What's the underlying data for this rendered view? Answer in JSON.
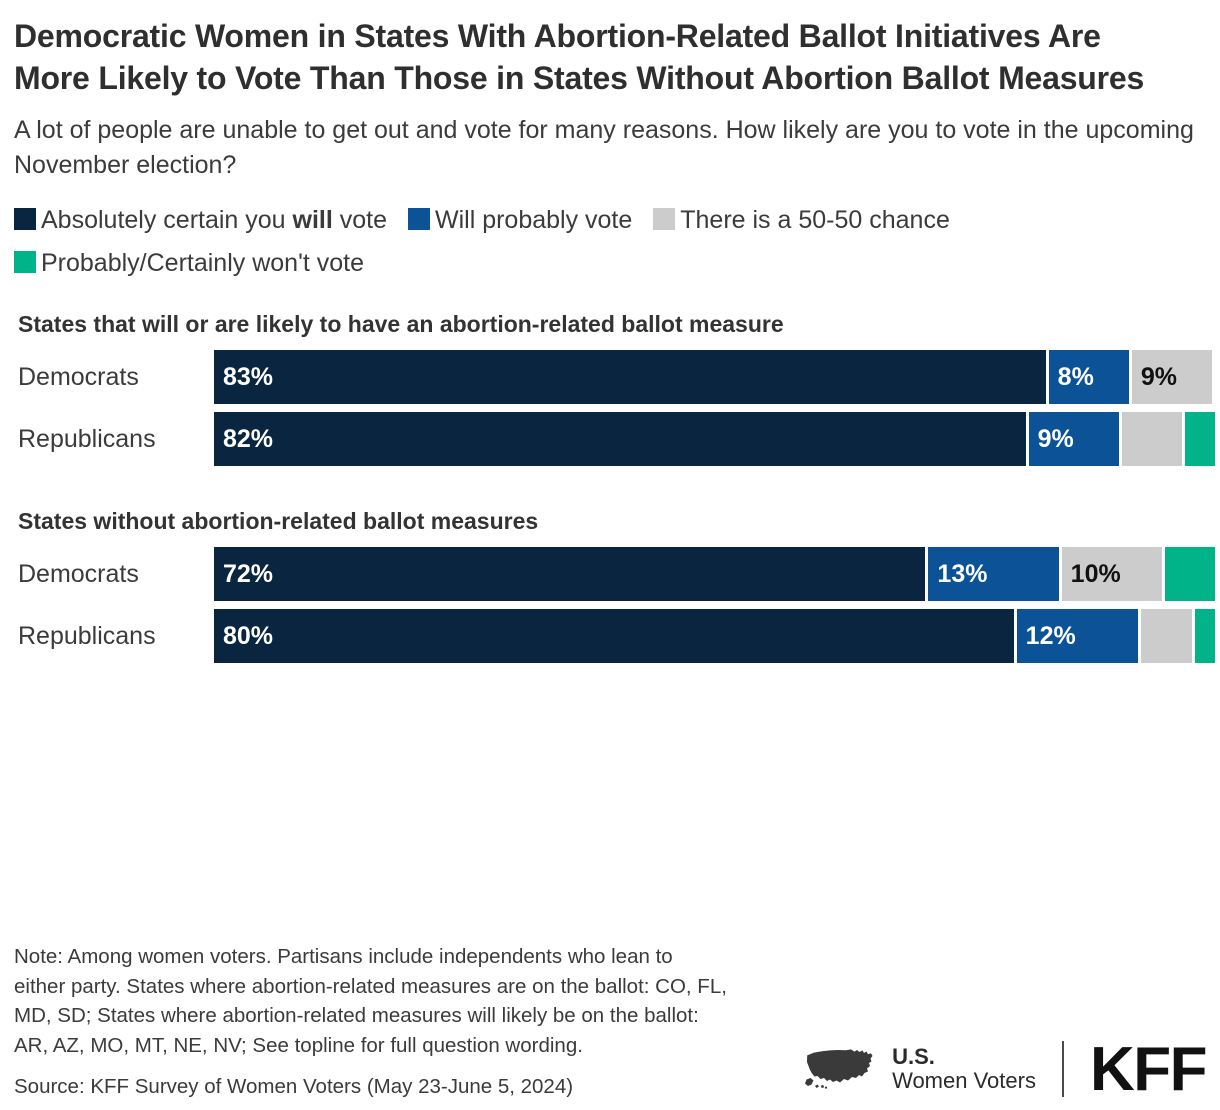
{
  "title": "Democratic Women in States With Abortion-Related Ballot Initiatives Are More Likely to Vote Than Those in States Without Abortion Ballot Measures",
  "subtitle": "A lot of people are unable to get out and vote for many reasons. How likely are you to vote in the upcoming November election?",
  "legend": [
    {
      "label_pre": "Absolutely certain you ",
      "label_bold": "will",
      "label_post": " vote",
      "color": "#0a2540",
      "name": "absolutely-certain-will-vote"
    },
    {
      "label_pre": "Will probably vote",
      "label_bold": "",
      "label_post": "",
      "color": "#0b5296",
      "name": "will-probably-vote"
    },
    {
      "label_pre": "There is a 50-50 chance",
      "label_bold": "",
      "label_post": "",
      "color": "#cccccc",
      "name": "fifty-fifty-chance"
    },
    {
      "label_pre": "Probably/Certainly won't vote",
      "label_bold": "",
      "label_post": "",
      "color": "#00b388",
      "name": "probably-certainly-wont-vote"
    }
  ],
  "groups": [
    {
      "header": "States that will or are likely to have an abortion-related ballot measure",
      "rows": [
        {
          "label": "Democrats",
          "segments": [
            {
              "value": 83,
              "text": "83%",
              "color": "#0a2540",
              "text_color": "light",
              "show_label": true
            },
            {
              "value": 8,
              "text": "8%",
              "color": "#0b5296",
              "text_color": "light",
              "show_label": true
            },
            {
              "value": 8,
              "text": "9%",
              "color": "#cccccc",
              "text_color": "dark",
              "show_label": true
            },
            {
              "value": 0,
              "text": "",
              "color": "#00b388",
              "text_color": "light",
              "show_label": false
            }
          ]
        },
        {
          "label": "Republicans",
          "segments": [
            {
              "value": 81,
              "text": "82%",
              "color": "#0a2540",
              "text_color": "light",
              "show_label": true
            },
            {
              "value": 9,
              "text": "9%",
              "color": "#0b5296",
              "text_color": "light",
              "show_label": true
            },
            {
              "value": 6,
              "text": "",
              "color": "#cccccc",
              "text_color": "dark",
              "show_label": false
            },
            {
              "value": 3,
              "text": "",
              "color": "#00b388",
              "text_color": "light",
              "show_label": false
            }
          ]
        }
      ]
    },
    {
      "header": "States without abortion-related ballot measures",
      "rows": [
        {
          "label": "Democrats",
          "segments": [
            {
              "value": 71,
              "text": "72%",
              "color": "#0a2540",
              "text_color": "light",
              "show_label": true
            },
            {
              "value": 13,
              "text": "13%",
              "color": "#0b5296",
              "text_color": "light",
              "show_label": true
            },
            {
              "value": 10,
              "text": "10%",
              "color": "#cccccc",
              "text_color": "dark",
              "show_label": true
            },
            {
              "value": 5,
              "text": "",
              "color": "#00b388",
              "text_color": "light",
              "show_label": false
            }
          ]
        },
        {
          "label": "Republicans",
          "segments": [
            {
              "value": 79,
              "text": "80%",
              "color": "#0a2540",
              "text_color": "light",
              "show_label": true
            },
            {
              "value": 12,
              "text": "12%",
              "color": "#0b5296",
              "text_color": "light",
              "show_label": true
            },
            {
              "value": 5,
              "text": "",
              "color": "#cccccc",
              "text_color": "dark",
              "show_label": false
            },
            {
              "value": 2,
              "text": "",
              "color": "#00b388",
              "text_color": "light",
              "show_label": false
            }
          ]
        }
      ]
    }
  ],
  "note": "Note: Among women voters. Partisans include independents who lean to either party. States where abortion-related measures are on the ballot: CO, FL, MD, SD; States where abortion-related measures will likely be on the ballot: AR, AZ, MO, MT, NE, NV; See topline for full question wording.",
  "source": "Source: KFF Survey of Women Voters (May 23-June 5, 2024)",
  "brand": {
    "uswv_line1": "U.S.",
    "uswv_line2": "Women Voters",
    "kff": "KFF"
  },
  "chart_data": {
    "type": "bar",
    "title": "Democratic Women in States With Abortion-Related Ballot Initiatives Are More Likely to Vote Than Those in States Without Abortion Ballot Measures",
    "subtitle": "A lot of people are unable to get out and vote for many reasons. How likely are you to vote in the upcoming November election?",
    "orientation": "horizontal",
    "stacked": true,
    "stack_mode": "percent",
    "xlabel": "",
    "ylabel": "",
    "xlim": [
      0,
      100
    ],
    "grid": false,
    "legend_position": "top",
    "legend_entries": [
      "Absolutely certain you will vote",
      "Will probably vote",
      "There is a 50-50 chance",
      "Probably/Certainly won't vote"
    ],
    "colors": [
      "#0a2540",
      "#0b5296",
      "#cccccc",
      "#00b388"
    ],
    "groups": [
      {
        "name": "States that will or are likely to have an abortion-related ballot measure",
        "categories": [
          "Democrats",
          "Republicans"
        ],
        "series": [
          {
            "name": "Absolutely certain you will vote",
            "values": [
              83,
              82
            ]
          },
          {
            "name": "Will probably vote",
            "values": [
              8,
              9
            ]
          },
          {
            "name": "There is a 50-50 chance",
            "values": [
              9,
              6
            ]
          },
          {
            "name": "Probably/Certainly won't vote",
            "values": [
              0,
              3
            ]
          }
        ],
        "labeled_values": [
          {
            "category": "Democrats",
            "labels": [
              "83%",
              "8%",
              "9%",
              ""
            ]
          },
          {
            "category": "Republicans",
            "labels": [
              "82%",
              "9%",
              "",
              ""
            ]
          }
        ]
      },
      {
        "name": "States without abortion-related ballot measures",
        "categories": [
          "Democrats",
          "Republicans"
        ],
        "series": [
          {
            "name": "Absolutely certain you will vote",
            "values": [
              72,
              80
            ]
          },
          {
            "name": "Will probably vote",
            "values": [
              13,
              12
            ]
          },
          {
            "name": "There is a 50-50 chance",
            "values": [
              10,
              5
            ]
          },
          {
            "name": "Probably/Certainly won't vote",
            "values": [
              5,
              2
            ]
          }
        ],
        "labeled_values": [
          {
            "category": "Democrats",
            "labels": [
              "72%",
              "13%",
              "10%",
              ""
            ]
          },
          {
            "category": "Republicans",
            "labels": [
              "80%",
              "12%",
              "",
              ""
            ]
          }
        ]
      }
    ],
    "note": "Note: Among women voters. Partisans include independents who lean to either party. States where abortion-related measures are on the ballot: CO, FL, MD, SD; States where abortion-related measures will likely be on the ballot: AR, AZ, MO, MT, NE, NV; See topline for full question wording.",
    "source": "Source: KFF Survey of Women Voters (May 23-June 5, 2024)"
  }
}
